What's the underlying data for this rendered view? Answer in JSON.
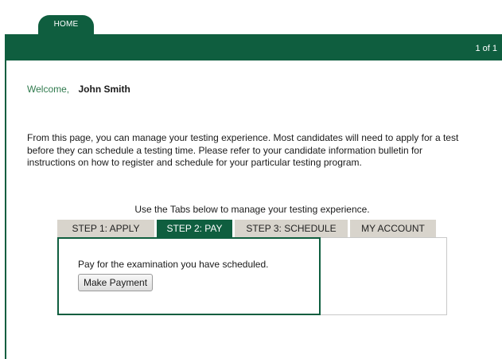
{
  "nav": {
    "home_label": "HOME"
  },
  "header": {
    "page_count": "1 of 1"
  },
  "welcome": {
    "label": "Welcome,",
    "user_name": "John Smith"
  },
  "intro": {
    "text": "From this page, you can manage your testing experience. Most candidates will need to apply for a test before they can schedule a testing time. Please refer to your candidate information bulletin for instructions on how to register and schedule for your particular testing program."
  },
  "tabs": {
    "caption": "Use the Tabs below to manage your testing experience.",
    "items": [
      {
        "label": "STEP 1: APPLY"
      },
      {
        "label": "STEP 2: PAY"
      },
      {
        "label": "STEP 3: SCHEDULE"
      },
      {
        "label": "MY ACCOUNT"
      }
    ],
    "active": "STEP 2: PAY"
  },
  "panel": {
    "text": "Pay for the examination you have scheduled.",
    "button_label": "Make Payment"
  },
  "colors": {
    "brand": "#0f5e3f",
    "tab_inactive": "#d8d4cc",
    "welcome": "#2f7a4d"
  }
}
